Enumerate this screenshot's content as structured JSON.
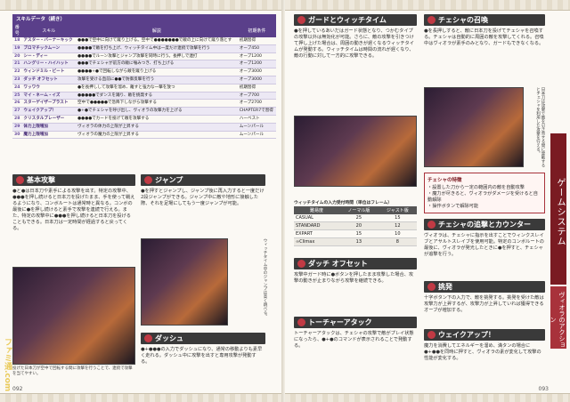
{
  "left": {
    "page_number": "092",
    "skill_table": {
      "title": "スキルデータ（続き）",
      "headers": [
        "番号",
        "スキル",
        "解説",
        "初期条件"
      ],
      "rows": [
        {
          "num": "18",
          "name": "アスター・バーナーキック",
          "desc": "●●●で空中に向けて蹴り上げる。空中で●●●●●●●で敵の上に向けて蹴り落とす",
          "cond": "初期習得"
        },
        {
          "num": "19",
          "name": "ブロマチックムーン",
          "desc": "●●●●で敵を打ち上げ、ウィッチタイム中は一度だけ連続で攻撃を行う",
          "cond": "オーブ450"
        },
        {
          "num": "20",
          "name": "シー・ディー",
          "desc": "●●●●でルーン攻撃とジャンプ攻撃を同時に行う。長押しで連打",
          "cond": "オーブ1200"
        },
        {
          "num": "21",
          "name": "ハングリー・ハイハット",
          "desc": "●●●でチェシャが前方の敵に噛みつき、打ち上げる",
          "cond": "オーブ1200"
        },
        {
          "num": "22",
          "name": "ウィンドミル・ビート",
          "desc": "●●●●+●で回転しながら敵を蹴り上げる",
          "cond": "オーブ3000"
        },
        {
          "num": "23",
          "name": "ダッチ オフセット",
          "desc": "攻撃を受ける直前に●●で防御反撃を行う",
          "cond": "オーブ3000"
        },
        {
          "num": "24",
          "name": "ワッワウ",
          "desc": "●を長押しして攻撃を溜め、離すと強力な一撃を放つ",
          "cond": "初期習得"
        },
        {
          "num": "25",
          "name": "マイ・ネーム・イズ",
          "desc": "●●●●●でダンスを踊り、敵を挑発する",
          "cond": "オーブ700"
        },
        {
          "num": "26",
          "name": "スターゲイザーブラスト",
          "desc": "空中で●●●●●で急降下しながら攻撃する",
          "cond": "オーブ2700"
        },
        {
          "num": "27",
          "name": "ウェイクアップ！",
          "desc": "●+●でチェシャを呼び出し、ヴィオラの攻撃力を上げる",
          "cond": "CHAPTER7で習得"
        },
        {
          "num": "28",
          "name": "クリスタルブレーザー",
          "desc": "●●●●でカードを投げて敵を攻撃する",
          "cond": "ハーベスト"
        },
        {
          "num": "29",
          "name": "体力上限増加",
          "desc": "ヴィオラの体力の上限が上昇する",
          "cond": "ムーンパール"
        },
        {
          "num": "30",
          "name": "魔力上限増加",
          "desc": "ヴィオラの魔力の上限が上昇する",
          "cond": "ムーンパール"
        }
      ]
    },
    "basic_attack": {
      "title": "基本攻撃",
      "text": "●と●は日本刀や素手による攻撃を出す。特定の攻撃中、●●●を押し続けると日本刀を投げたまま、手を使って戦えるようになり、コンボルートは通常時と異なる。コンボの最後に●を押し続けると素手で攻撃を連続で行える。また、特定の攻撃中に●●●を押し続けると日本刀を投げることもできる。日本刀は一定時間が経過すると戻ってくる。"
    },
    "jump": {
      "title": "ジャンプ",
      "text": "●を押すとジャンプし、ジャンプ後に再入力すると一度だけ2段ジャンプができる。ジャンプ中に敵や地形に接触した際、それを足場にしてもう一度ジャンプが可能。"
    },
    "dash": {
      "title": "ダッシュ",
      "text": "●+●●●の入力でダッシュになり、通常の移動よりも素早く走れる。ダッシュ中に攻撃を出すと専用攻撃が発動する。"
    },
    "photo_caption_left": "投げた日本刀が空中で回転する間に攻撃を行うことで、連続で攻撃を当てやすい。",
    "photo_caption_mid": "ウィッチタイム中のジャンプは高く跳べる。"
  },
  "right": {
    "page_number": "093",
    "side_tab": "ゲームシステム",
    "side_sub": "ヴィオラのアクション",
    "guard": {
      "title": "ガードとウィッチタイム",
      "text": "●を押しているあいだはガード状態となり、つかむタイプの攻撃以外は無効化が可能。さらに、敵の攻撃を引きつけて押し上げた場合は、周囲の動きが遅くなるウィッチタイムが発動する。ウィッチタイムは時間の流れが遅くなり、敵の行動に対して一方的に攻撃できる。"
    },
    "window_table": {
      "title": "ウィッチタイムの入力受付時間（単位はフレーム）",
      "headers": [
        "難易度",
        "ノーマル版",
        "ジャスト版"
      ],
      "rows": [
        [
          "CASUAL",
          "25",
          "15"
        ],
        [
          "STANDARD",
          "20",
          "12"
        ],
        [
          "EXPART",
          "15",
          "10"
        ],
        [
          "∞Climax",
          "13",
          "8"
        ]
      ]
    },
    "offset": {
      "title": "ダッチ オフセット",
      "text": "攻撃中ガード時に●ボタンを押したまま攻撃した場合、攻撃の動きが止まりながら攻撃を継続できる。"
    },
    "topple": {
      "title": "トーチャーアタック",
      "text": "トーチャーアタックは、チェシャの攻撃で敵がプレイ状態になったら、●+●のコマンドが表示されることで発動する。"
    },
    "cheshire": {
      "title": "チェシャの召喚",
      "text": "●を長押しすると、敵に日本刀を投げてチェシャを召喚する。チェシャは自動的に周囲の敵を攻撃してくれる。召喚中はヴィオラが素手のみとなり、ガードもできなくなる。"
    },
    "note": {
      "title": "チェシャの特徴",
      "items": [
        "設置した刀から一定の範囲内の敵を自動攻撃",
        "魔力が尽きると、ヴィオラがダメージを受けると自動解除",
        "操作ボタンで解除可能"
      ]
    },
    "cheshire_combo": {
      "title": "チェシャの追撃とカウンター",
      "text": "ヴィオラは、チェシャに指示を出すことでウィンクスレイブとアサルトスレイブを使用可能。特定のコンボルートの最後に、ヴィオラが発光したときに●を押すと、チェシャが追撃を行う。"
    },
    "provoke": {
      "title": "挑発",
      "text": "十字ボタン下の入力で、敵を挑発する。挑発を受けた敵は攻撃力が上昇するが、攻撃力が上昇していれば獲得できるオーブが増加する。"
    },
    "wakeup": {
      "title": "ウェイクアップ！",
      "text": "魔力を消費してエネルギーを溜め、満タンの場合に●+●●を同時に押すと、ヴィオラの素が変化して攻撃の性能が変化する。"
    },
    "photo_caption": "日本刀は攻撃で敵を引き寄せる間に発動するとチェシャを利用した攻撃を行える。"
  },
  "watermark": "ファミ通.com"
}
